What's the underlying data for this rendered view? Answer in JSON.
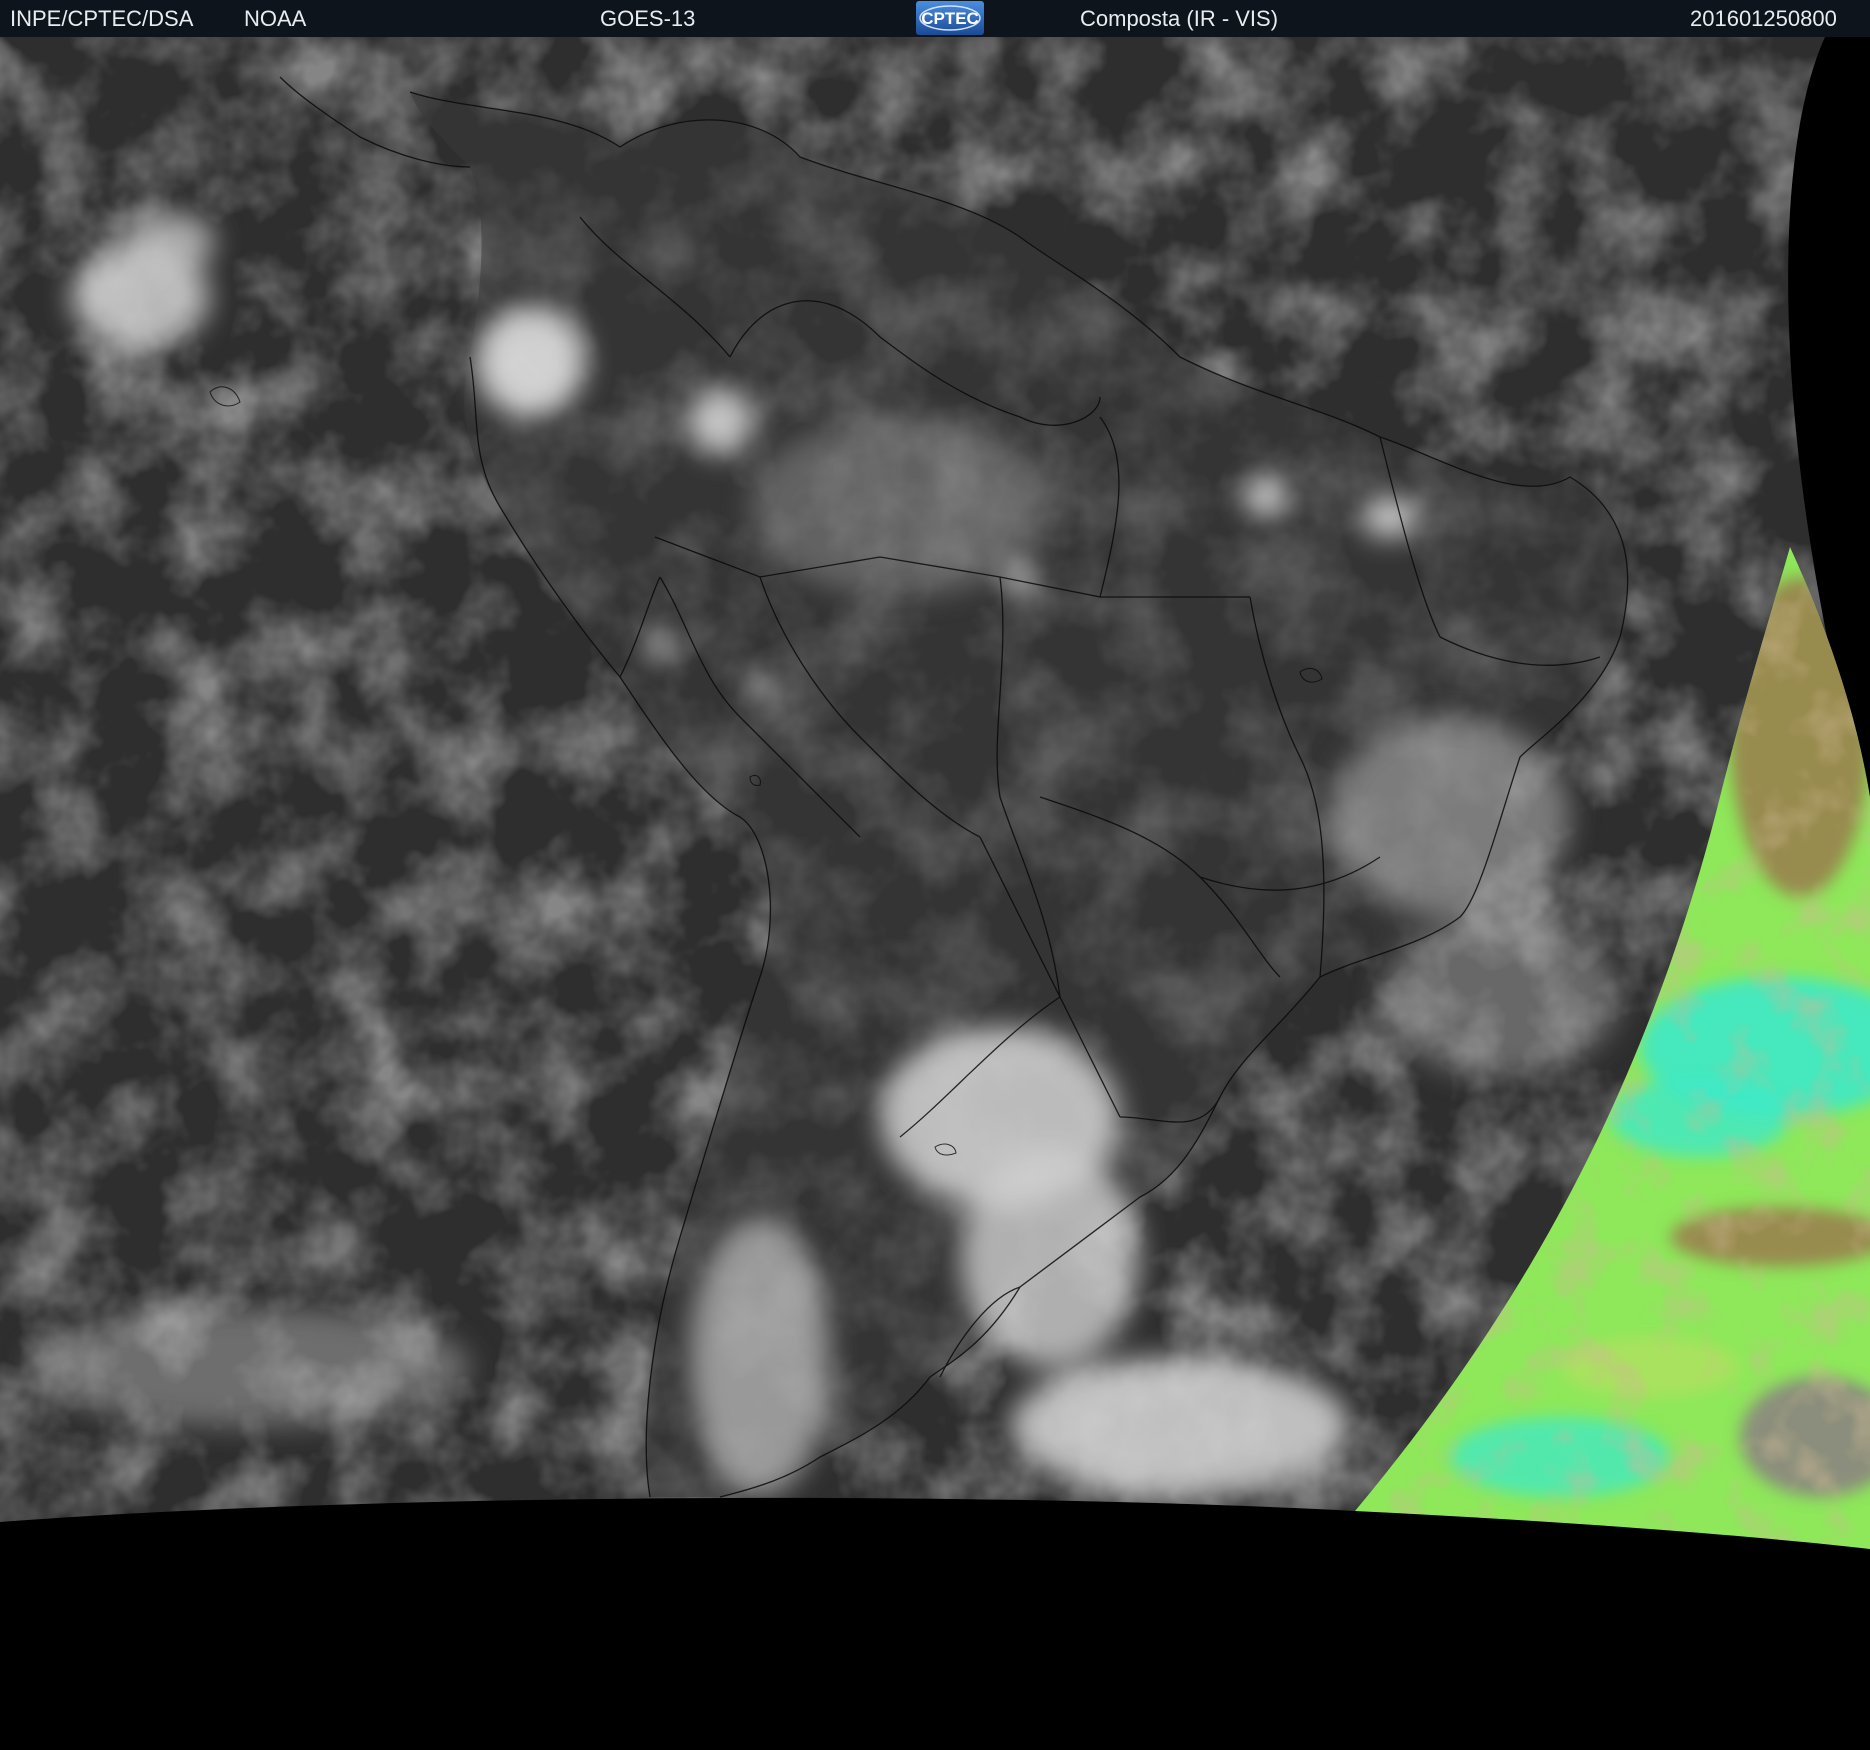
{
  "header": {
    "agency": "INPE/CPTEC/DSA",
    "provider": "NOAA",
    "satellite": "GOES-13",
    "logo_text": "CPTEC",
    "product": "Composta (IR - VIS)",
    "timestamp": "201601250800"
  },
  "colors": {
    "header_bg": "#0d141b",
    "header_text": "#e8ecf0",
    "ocean_ir": "#2e2e2e",
    "land_ir": "#353535",
    "cloud_bright": "#d9d9d9",
    "space": "#000000",
    "vis_green": "#8ee85a",
    "vis_cyan": "#3fe8c8",
    "vis_brown": "#9a7a4e",
    "logo_blue": "#2a64b8"
  }
}
